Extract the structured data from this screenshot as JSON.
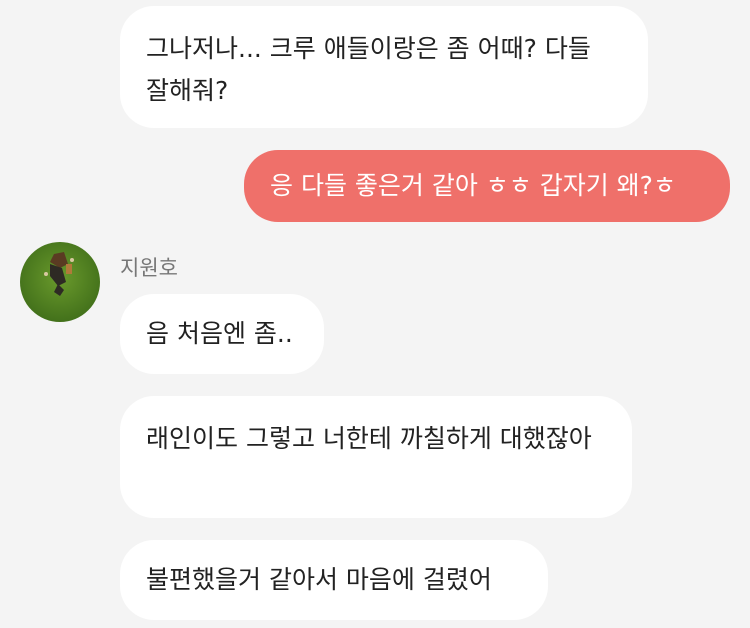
{
  "messages": [
    {
      "from": "other",
      "text": "그나저나... 크루 애들이랑은 좀 어때? 다들 잘해줘?"
    },
    {
      "from": "me",
      "text": "응 다들 좋은거 같아 ㅎㅎ 갑자기 왜?ㅎ"
    },
    {
      "from": "other",
      "text": "음 처음엔 좀.."
    },
    {
      "from": "other",
      "text": "래인이도 그렇고 너한테 까칠하게 대했잖아"
    },
    {
      "from": "other",
      "text": "불편했을거 같아서 마음에 걸렸어"
    }
  ],
  "sender": {
    "name": "지원호",
    "avatar_icon": "profile-photo-grass"
  },
  "colors": {
    "my_bubble": "#ef706a",
    "other_bubble": "#ffffff",
    "background": "#f4f4f4"
  }
}
